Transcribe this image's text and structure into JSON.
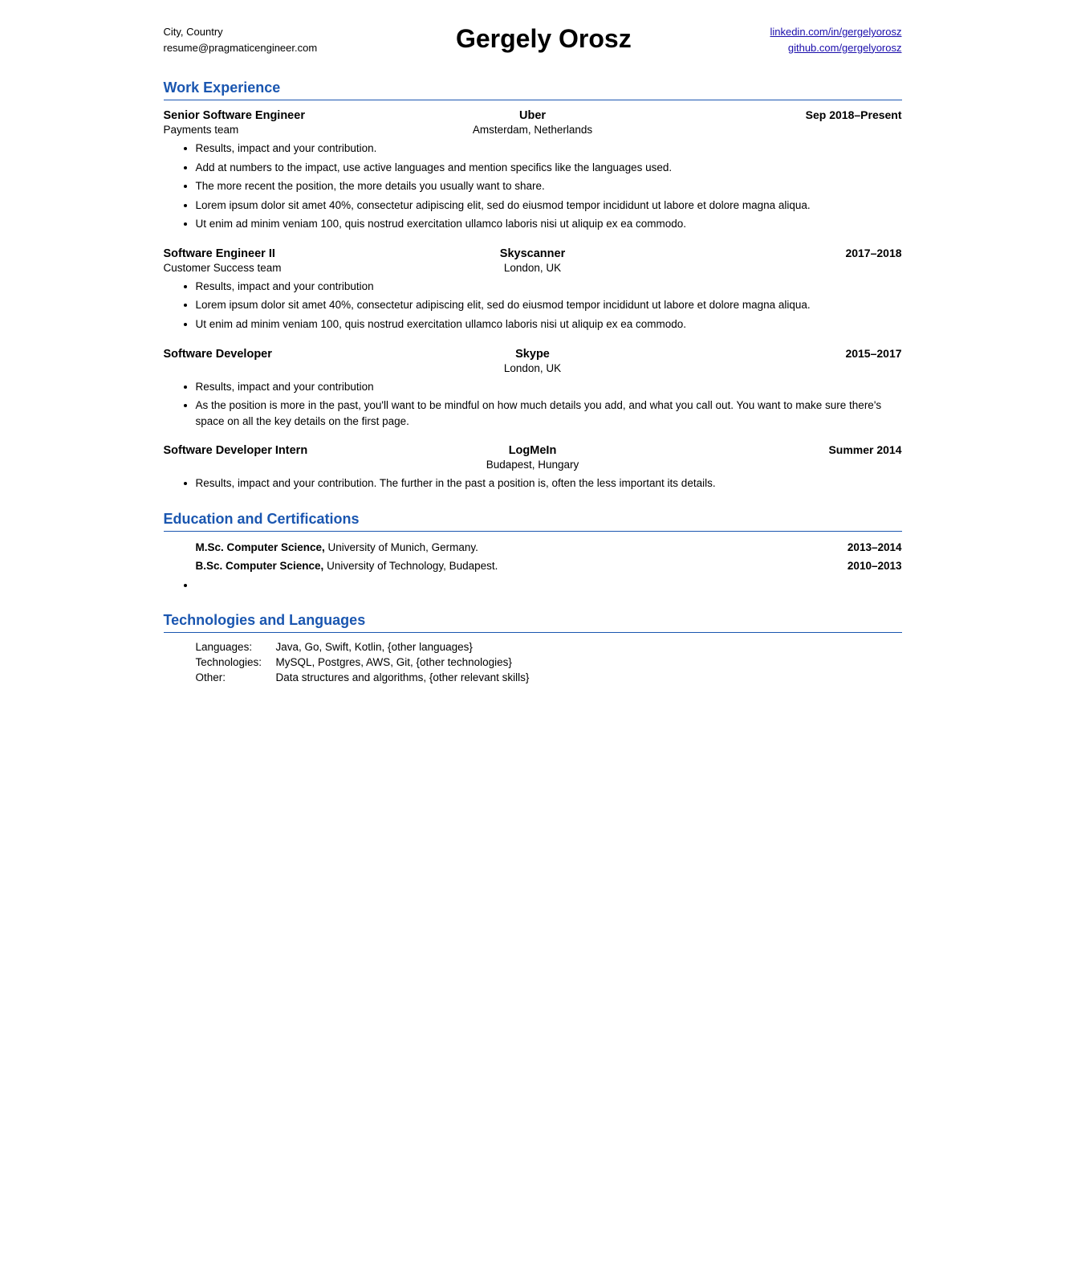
{
  "header": {
    "left_line1": "City, Country",
    "left_line2": "resume@pragmaticengineer.com",
    "name": "Gergely Orosz",
    "link1": "linkedin.com/in/gergelyorosz",
    "link2": "github.com/gergelyorosz"
  },
  "sections": {
    "work_experience": {
      "title": "Work Experience",
      "jobs": [
        {
          "title": "Senior Software Engineer",
          "company": "Uber",
          "date": "Sep 2018–Present",
          "team": "Payments team",
          "location": "Amsterdam, Netherlands",
          "bullets": [
            "Results, impact and your contribution.",
            "Add at numbers to the impact, use active languages and mention specifics like the languages used.",
            "The more recent the position, the more details you usually want to share.",
            "Lorem ipsum dolor sit amet 40%, consectetur adipiscing elit, sed do eiusmod tempor incididunt ut labore et dolore magna aliqua.",
            "Ut enim ad minim veniam 100, quis nostrud exercitation ullamco laboris nisi ut aliquip ex ea commodo."
          ]
        },
        {
          "title": "Software Engineer II",
          "company": "Skyscanner",
          "date": "2017–2018",
          "team": "Customer Success team",
          "location": "London, UK",
          "bullets": [
            "Results, impact and your contribution",
            "Lorem ipsum dolor sit amet 40%, consectetur adipiscing elit, sed do eiusmod tempor incididunt ut labore et dolore magna aliqua.",
            "Ut enim ad minim veniam 100, quis nostrud exercitation ullamco laboris nisi ut aliquip ex ea commodo."
          ]
        },
        {
          "title": "Software Developer",
          "company": "Skype",
          "date": "2015–2017",
          "team": "",
          "location": "London, UK",
          "bullets": [
            "Results, impact and your contribution",
            "As the position is more in the past, you'll want to be mindful on how much details you add, and what you call out. You want to make sure there's space on all the key details on the first page."
          ]
        },
        {
          "title": "Software Developer Intern",
          "company": "LogMeIn",
          "date": "Summer 2014",
          "team": "",
          "location": "Budapest, Hungary",
          "bullets": [
            "Results, impact and your contribution. The further in the past a position is, often the less important its details."
          ]
        }
      ]
    },
    "education": {
      "title": "Education and Certifications",
      "items": [
        {
          "degree": "M.Sc. Computer Science,",
          "school": " University of Munich, Germany.",
          "date": "2013–2014"
        },
        {
          "degree": "B.Sc. Computer Science,",
          "school": " University of Technology, Budapest.",
          "date": "2010–2013"
        },
        {
          "degree": "",
          "school": "",
          "date": ""
        }
      ]
    },
    "technologies": {
      "title": "Technologies and Languages",
      "items": [
        {
          "label": "Languages:",
          "value": "Java, Go, Swift, Kotlin, {other languages}"
        },
        {
          "label": "Technologies:",
          "value": "MySQL, Postgres, AWS, Git, {other technologies}"
        },
        {
          "label": "Other:",
          "value": "Data structures and algorithms, {other relevant skills}"
        }
      ]
    }
  }
}
